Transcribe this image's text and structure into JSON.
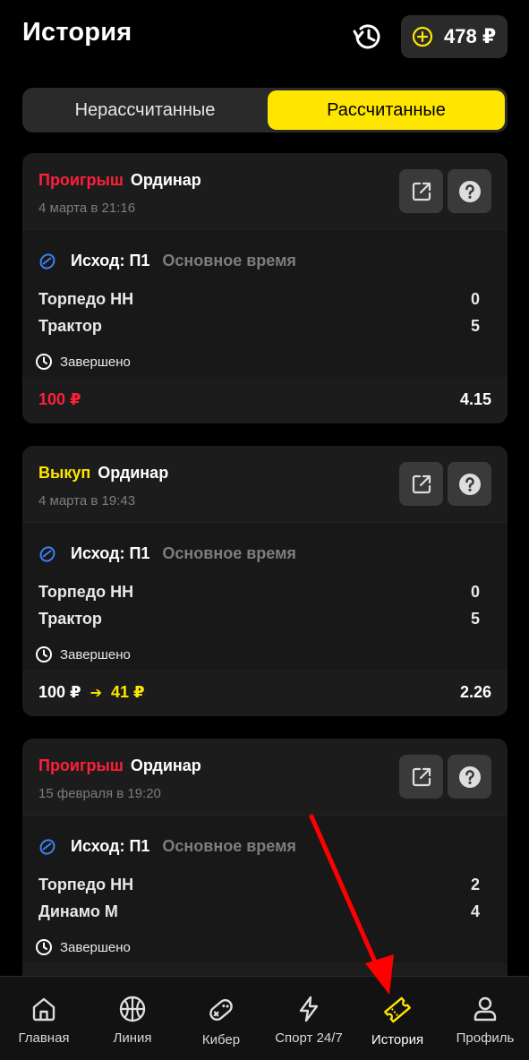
{
  "header": {
    "title": "История",
    "history_icon": "history-icon",
    "balance": "478 ₽",
    "add_icon": "plus-circle-icon"
  },
  "tabs": {
    "unsettled": "Нерассчитанные",
    "settled": "Рассчитанные",
    "active": "settled"
  },
  "bets": [
    {
      "status": "Проигрыш",
      "status_kind": "lost",
      "type": "Ординар",
      "date": "4 марта в 21:16",
      "outcome": "Исход: П1",
      "period": "Основное время",
      "team1": "Торпедо НН",
      "score1": "0",
      "team2": "Трактор",
      "score2": "5",
      "event_status": "Завершено",
      "stake": "100 ₽",
      "odds": "4.15"
    },
    {
      "status": "Выкуп",
      "status_kind": "buyout",
      "type": "Ординар",
      "date": "4 марта в 19:43",
      "outcome": "Исход: П1",
      "period": "Основное время",
      "team1": "Торпедо НН",
      "score1": "0",
      "team2": "Трактор",
      "score2": "5",
      "event_status": "Завершено",
      "stake": "100 ₽",
      "cashout": "41 ₽",
      "odds": "2.26"
    },
    {
      "status": "Проигрыш",
      "status_kind": "lost",
      "type": "Ординар",
      "date": "15 февраля в 19:20",
      "outcome": "Исход: П1",
      "period": "Основное время",
      "team1": "Торпедо НН",
      "score1": "2",
      "team2": "Динамо М",
      "score2": "4",
      "event_status": "Завершено"
    }
  ],
  "nav": {
    "items": [
      {
        "label": "Главная",
        "icon": "home-icon"
      },
      {
        "label": "Линия",
        "icon": "basketball-icon"
      },
      {
        "label": "Кибер",
        "icon": "gamepad-icon"
      },
      {
        "label": "Спорт 24/7",
        "icon": "lightning-icon"
      },
      {
        "label": "История",
        "icon": "ticket-icon"
      },
      {
        "label": "Профиль",
        "icon": "user-icon"
      }
    ],
    "active": "История"
  },
  "colors": {
    "accent": "#ffe600",
    "lost": "#ff1f3a",
    "annotation_arrow": "#ff0000"
  }
}
